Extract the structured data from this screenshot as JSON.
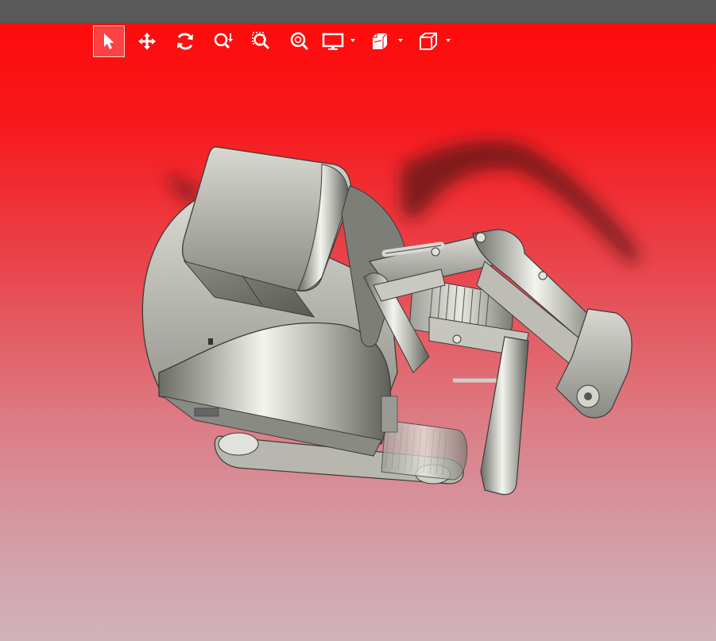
{
  "window": {
    "title_bar_color": "#595959"
  },
  "viewport": {
    "background_top_color": "#ff0b0b",
    "background_bottom_color": "#cfb3bb"
  },
  "toolbar": {
    "tools": [
      {
        "name": "select-tool",
        "icon": "cursor-arrow-icon",
        "active": true
      },
      {
        "name": "pan-tool",
        "icon": "move-arrows-icon"
      },
      {
        "name": "rotate-tool",
        "icon": "rotate-icon"
      },
      {
        "name": "zoom-tool",
        "icon": "zoom-updown-icon"
      },
      {
        "name": "zoom-window-tool",
        "icon": "zoom-window-icon"
      },
      {
        "name": "zoom-fit-tool",
        "icon": "zoom-fit-icon"
      },
      {
        "name": "display-mode-menu",
        "icon": "monitor-icon",
        "dropdown": true
      },
      {
        "name": "section-view-menu",
        "icon": "section-cube-icon",
        "dropdown": true
      },
      {
        "name": "view-orientation-menu",
        "icon": "wireframe-cube-icon",
        "dropdown": true
      }
    ]
  },
  "model": {
    "subject": "excavator-3d-model",
    "shading": "gray-metallic"
  }
}
